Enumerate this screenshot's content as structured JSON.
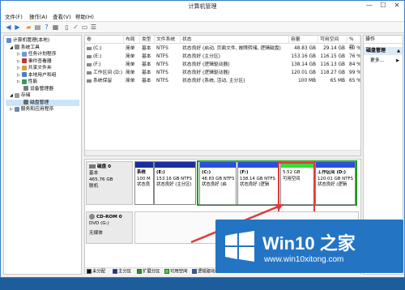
{
  "window": {
    "title": "计算机管理",
    "minimize": "—",
    "maximize": "☐",
    "close": "✕"
  },
  "menu": [
    "文件(F)",
    "操作(A)",
    "查看(V)",
    "帮助(H)"
  ],
  "tree": [
    {
      "label": "计算机管理(本地)",
      "indent": 0
    },
    {
      "label": "系统工具",
      "indent": 1
    },
    {
      "label": "任务计划程序",
      "indent": 2
    },
    {
      "label": "事件查看器",
      "indent": 2
    },
    {
      "label": "共享文件夹",
      "indent": 2
    },
    {
      "label": "本地用户和组",
      "indent": 2
    },
    {
      "label": "性能",
      "indent": 2
    },
    {
      "label": "设备管理器",
      "indent": 2
    },
    {
      "label": "存储",
      "indent": 1
    },
    {
      "label": "磁盘管理",
      "indent": 2
    },
    {
      "label": "服务和应用程序",
      "indent": 1
    }
  ],
  "volumes": {
    "headers": [
      "卷",
      "布局",
      "类型",
      "文件系统",
      "状态",
      "容量",
      "可用空间",
      "% 可"
    ],
    "rows": [
      [
        "(C:)",
        "简单",
        "基本",
        "NTFS",
        "状态良好 (启动, 页面文件, 故障转储, 逻辑磁盘)",
        "48.83 GB",
        "29.14 GB",
        "60 %"
      ],
      [
        "(E:)",
        "简单",
        "基本",
        "NTFS",
        "状态良好 (主分区)",
        "153.16 GB",
        "116.15 GB",
        "76 %"
      ],
      [
        "(F:)",
        "简单",
        "基本",
        "NTFS",
        "状态良好 (逻辑驱动器)",
        "138.14 GB",
        "116.13 GB",
        "84 %"
      ],
      [
        "工作区间 (D:)",
        "简单",
        "基本",
        "NTFS",
        "状态良好 (逻辑驱动器)",
        "120.01 GB",
        "118.27 GB",
        "99 %"
      ],
      [
        "系统保留",
        "简单",
        "基本",
        "NTFS",
        "状态良好 (系统, 活动, 主分区)",
        "100 MB",
        "65 MB",
        "65 %"
      ]
    ]
  },
  "actions": {
    "header": "操作",
    "section": "磁盘管理",
    "more": "更多..."
  },
  "disk0": {
    "name": "磁盘 0",
    "type": "基本",
    "size": "465.76 GB",
    "status": "联机"
  },
  "partitions": [
    {
      "name": "系统",
      "line1": "100 M",
      "line2": "状态良"
    },
    {
      "name": "(E:)",
      "line1": "153.16 GB NTFS",
      "line2": "状态良好 (主分区)"
    },
    {
      "name": "(C:)",
      "line1": "48.83 GB NTFS",
      "line2": "状态良好 (启"
    },
    {
      "name": "(F:)",
      "line1": "138.14 GB NTFS",
      "line2": "状态良好 (逻辑"
    },
    {
      "name": "",
      "line1": "5.52 GB",
      "line2": "可用空间"
    },
    {
      "name": "工作区间 (D:)",
      "line1": "120.01 GB NTFS",
      "line2": "状态良好 (逻辑"
    }
  ],
  "cdrom": {
    "name": "CD-ROM 0",
    "type": "DVD (G:)",
    "status": "无媒体"
  },
  "legend": [
    "未分配",
    "主分区",
    "扩展分区",
    "可用空间",
    "逻辑驱动器"
  ],
  "colors": {
    "primary": "#1a2ea0",
    "logical": "#2850d8",
    "free": "#32e032",
    "extended": "#1c9a1c",
    "unallocated": "#111111",
    "highlight": "#e23a3a"
  },
  "watermark": {
    "brand": "Win10 之家",
    "url": "www.win10xitong.com"
  }
}
